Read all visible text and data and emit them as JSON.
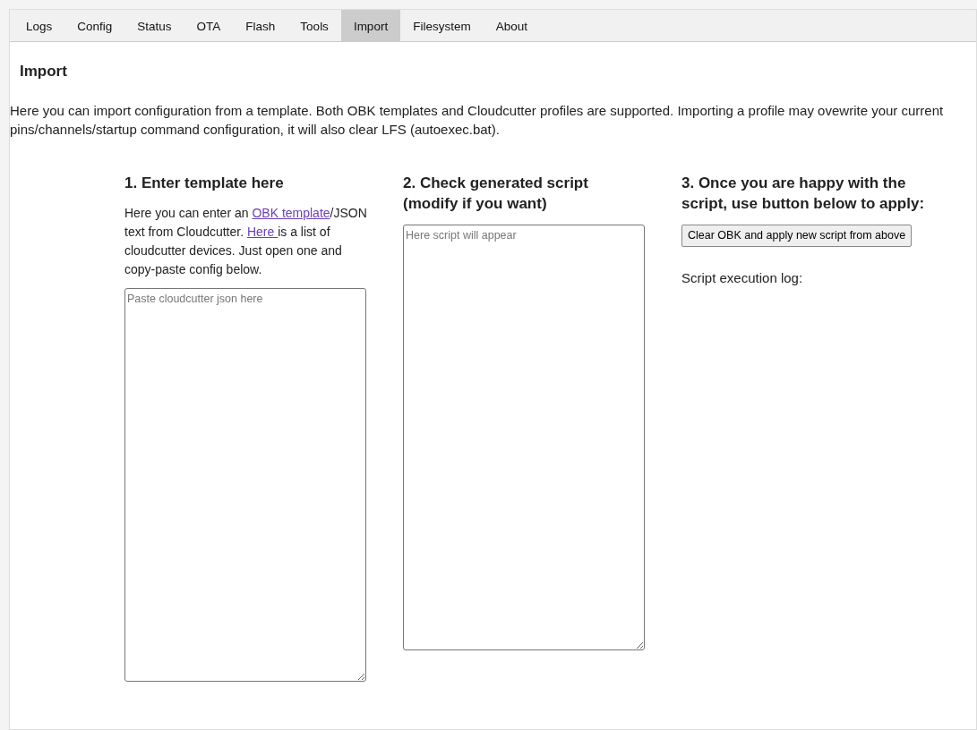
{
  "tabs": [
    {
      "label": "Logs",
      "selected": false
    },
    {
      "label": "Config",
      "selected": false
    },
    {
      "label": "Status",
      "selected": false
    },
    {
      "label": "OTA",
      "selected": false
    },
    {
      "label": "Flash",
      "selected": false
    },
    {
      "label": "Tools",
      "selected": false
    },
    {
      "label": "Import",
      "selected": true
    },
    {
      "label": "Filesystem",
      "selected": false
    },
    {
      "label": "About",
      "selected": false
    }
  ],
  "page_title": "Import",
  "description": "Here you can import configuration from a template. Both OBK templates and Cloudcutter profiles are supported. Importing a profile may ovewrite your current pins/channels/startup command configuration, it will also clear LFS (autoexec.bat).",
  "columns": [
    {
      "heading": "1. Enter template here",
      "intro": [
        {
          "kind": "text",
          "text": "Here you can enter an "
        },
        {
          "kind": "link",
          "text": "OBK template"
        },
        {
          "kind": "text",
          "text": "/JSON text from Cloudcutter. "
        },
        {
          "kind": "link",
          "text": "Here "
        },
        {
          "kind": "text",
          "text": "is a list of cloudcutter devices. Just open one and copy-paste config below."
        }
      ],
      "field": {
        "placeholder": "Paste cloudcutter json here"
      }
    },
    {
      "heading": "2. Check generated script (modify if you want)",
      "field": {
        "placeholder": "Here script will appear"
      }
    },
    {
      "heading": "3. Once you are happy with the script, use button below to apply:",
      "button": "Clear OBK and apply new script from above",
      "log_label": "Script execution log:"
    }
  ]
}
